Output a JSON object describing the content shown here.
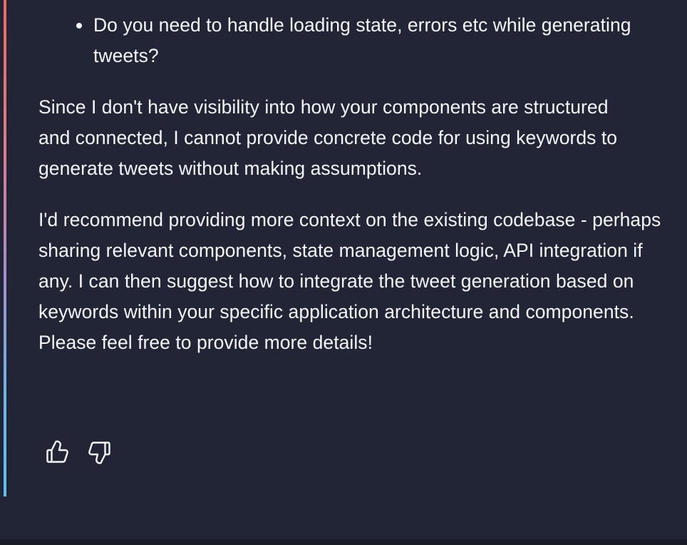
{
  "message": {
    "bullets": [
      {
        "text": "Do you need to handle loading state, errors etc while generating tweets?"
      }
    ],
    "paragraphs": [
      {
        "text": "Since I don't have visibility into how your components are structured and connected, I cannot provide concrete code for using keywords to generate tweets without making assumptions."
      },
      {
        "text": "I'd recommend providing more context on the existing codebase - perhaps sharing relevant components, state management logic, API integration if any. I can then suggest how to integrate the tweet generation based on keywords within your specific application architecture and components. Please feel free to provide more details!"
      }
    ]
  },
  "feedback": {
    "icons": [
      "thumbs-up-icon",
      "thumbs-down-icon"
    ]
  },
  "colors": {
    "background": "#212536",
    "text": "#f5f6f9",
    "accent_top": "#f06a5a",
    "accent_bottom": "#5cc0ef"
  }
}
